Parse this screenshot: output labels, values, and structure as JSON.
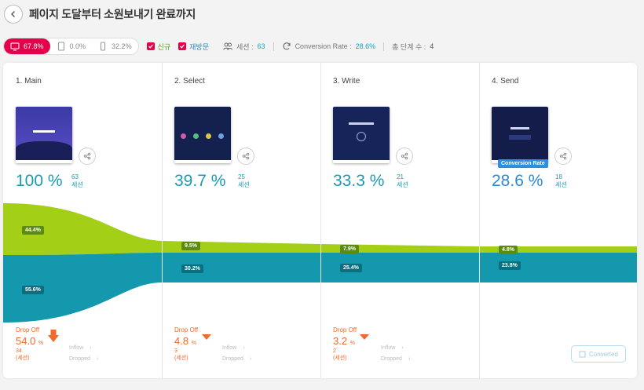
{
  "header": {
    "title": "페이지 도달부터 소원보내기 완료까지"
  },
  "filters": {
    "devices": [
      {
        "icon": "desktop-icon",
        "value": "67.8%"
      },
      {
        "icon": "tablet-icon",
        "value": "0.0%"
      },
      {
        "icon": "mobile-icon",
        "value": "32.2%"
      }
    ],
    "new_label": "신규",
    "returning_label": "재방문",
    "session_label": "세션 :",
    "session_value": "63",
    "conversion_label": "Conversion Rate :",
    "conversion_value": "28.6%",
    "steps_label": "총 단계 수 :",
    "steps_value": "4"
  },
  "steps": [
    {
      "name": "1. Main",
      "pct": "100 %",
      "sessions": "63",
      "session_unit": "세션",
      "green_label": "44.4%",
      "blue_label": "55.6%",
      "green_share": 0.444,
      "blue_share": 0.556,
      "drop_title": "Drop Off",
      "drop_pct": "54.0",
      "drop_pct_unit": "%",
      "drop_count": "34",
      "drop_unit": "(세션)"
    },
    {
      "name": "2. Select",
      "pct": "39.7 %",
      "sessions": "25",
      "session_unit": "세션",
      "green_label": "9.5%",
      "blue_label": "30.2%",
      "green_share": 0.095,
      "blue_share": 0.302,
      "drop_title": "Drop Off",
      "drop_pct": "4.8",
      "drop_pct_unit": "%",
      "drop_count": "3",
      "drop_unit": "(세션)"
    },
    {
      "name": "3. Write",
      "pct": "33.3 %",
      "sessions": "21",
      "session_unit": "세션",
      "green_label": "7.9%",
      "blue_label": "25.4%",
      "green_share": 0.079,
      "blue_share": 0.254,
      "drop_title": "Drop Off",
      "drop_pct": "3.2",
      "drop_pct_unit": "%",
      "drop_count": "2",
      "drop_unit": "(세션)"
    },
    {
      "name": "4. Send",
      "pct": "28.6 %",
      "sessions": "18",
      "session_unit": "세션",
      "green_label": "4.8%",
      "blue_label": "23.8%",
      "green_share": 0.048,
      "blue_share": 0.238,
      "conversion_badge": "Conversion Rate"
    }
  ],
  "inflow_label": "Inflow",
  "dropped_label": "Dropped",
  "converted_label": "Converted",
  "colors": {
    "accent": "#e5004c",
    "green": "#a3cf16",
    "blue": "#1398ad",
    "drop": "#f06a2a"
  }
}
